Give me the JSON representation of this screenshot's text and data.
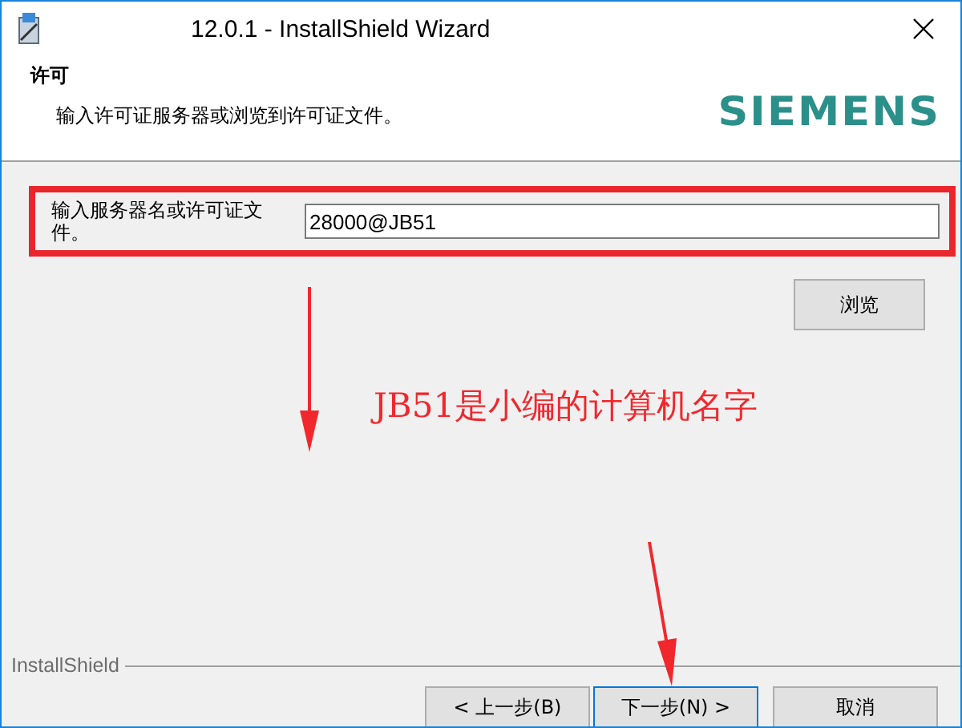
{
  "window": {
    "title": "12.0.1 - InstallShield Wizard"
  },
  "header": {
    "title": "许可",
    "subtitle": "输入许可证服务器或浏览到许可证文件。",
    "logo": "SIEMENS"
  },
  "license_field": {
    "label": "输入服务器名或许可证文件。",
    "value": "28000@JB51"
  },
  "browse_button": "浏览",
  "annotation": {
    "text": "JB51是小编的计算机名字"
  },
  "footer": {
    "brand": "InstallShield"
  },
  "buttons": [
    {
      "label": "< 上一步(B)",
      "focused": false
    },
    {
      "label": "下一步(N) >",
      "focused": true
    },
    {
      "label": "取消",
      "focused": false
    }
  ]
}
